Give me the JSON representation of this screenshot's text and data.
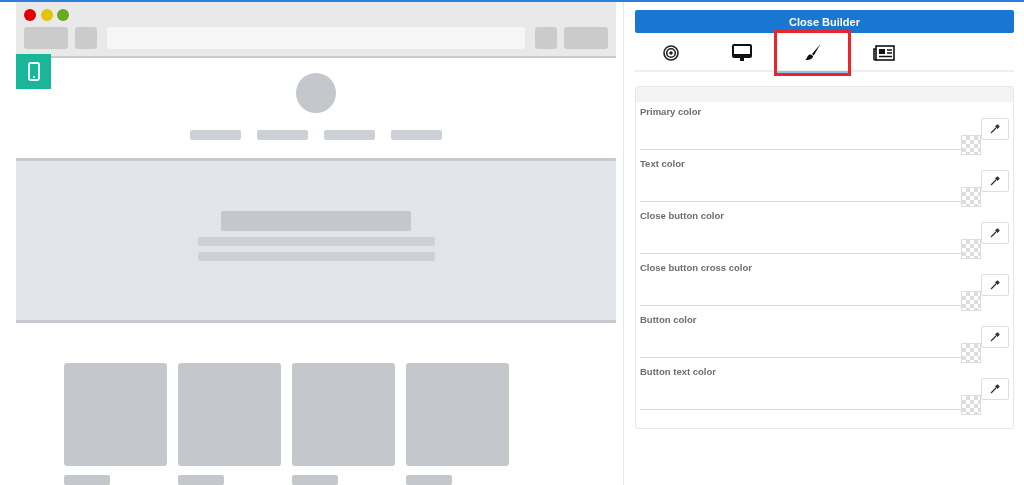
{
  "close_button": {
    "label": "Close Builder"
  },
  "tabs": [
    {
      "kind": "target",
      "selected": false
    },
    {
      "kind": "monitor",
      "selected": false
    },
    {
      "kind": "brush",
      "selected": true
    },
    {
      "kind": "newspaper",
      "selected": false
    }
  ],
  "color_fields": [
    {
      "label": "Primary color"
    },
    {
      "label": "Text color"
    },
    {
      "label": "Close button color"
    },
    {
      "label": "Close button cross color"
    },
    {
      "label": "Button color"
    },
    {
      "label": "Button text color"
    }
  ]
}
